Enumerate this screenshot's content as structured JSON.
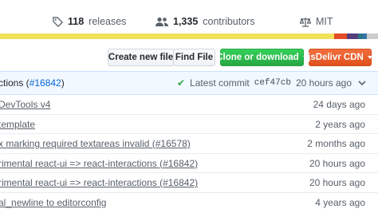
{
  "summary": {
    "releases": {
      "icon": "tag-icon",
      "count": "118",
      "label": "releases"
    },
    "contributors": {
      "icon": "people-icon",
      "count": "1,335",
      "label": "contributors"
    },
    "license": {
      "icon": "law-icon",
      "label": "MIT"
    }
  },
  "language_bar": {
    "segments": [
      {
        "color": "#f1e05a",
        "fraction": 0.883
      },
      {
        "color": "#e34c26",
        "fraction": 0.035
      },
      {
        "color": "#563d7c",
        "fraction": 0.03
      },
      {
        "color": "#2b7489",
        "fraction": 0.012
      },
      {
        "color": "#3572A5",
        "fraction": 0.01
      },
      {
        "color": "#cccccc",
        "fraction": 0.03
      }
    ]
  },
  "buttons": {
    "create_file": "Create new file",
    "find_file": "Find File",
    "clone": "Clone or download",
    "jsdelivr": "jsDelivr CDN"
  },
  "latest_commit": {
    "message_prefix": "ctions (",
    "message_link": "#16842",
    "message_suffix": ")",
    "label": "Latest commit",
    "sha": "cef47cb",
    "age": "20 hours ago"
  },
  "file_rows": [
    {
      "message": "DevTools v4",
      "age": "24 days ago"
    },
    {
      "message": "template",
      "age": "2 years ago"
    },
    {
      "message": "x marking required textareas invalid (#16578)",
      "age": "2 months ago"
    },
    {
      "message": "rimental react-ui => react-interactions (#16842)",
      "age": "20 hours ago"
    },
    {
      "message": "rimental react-ui => react-interactions (#16842)",
      "age": "20 hours ago"
    },
    {
      "message": "al_newline to editorconfig",
      "age": "4 years ago"
    }
  ],
  "colors": {
    "green": "#28a745",
    "orange": "#e0521d",
    "link": "#0366d6",
    "commit_bg": "#f1f8ff"
  }
}
